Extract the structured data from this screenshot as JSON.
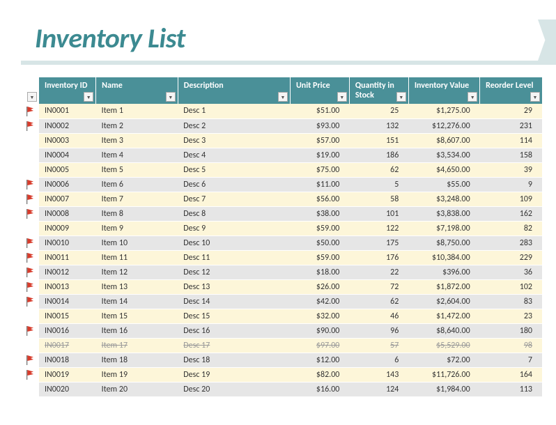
{
  "title": "Inventory List",
  "columns": [
    {
      "key": "id",
      "label": "Inventory ID"
    },
    {
      "key": "name",
      "label": "Name"
    },
    {
      "key": "desc",
      "label": "Description"
    },
    {
      "key": "price",
      "label": "Unit Price"
    },
    {
      "key": "qty",
      "label": "Quantity in Stock"
    },
    {
      "key": "value",
      "label": "Inventory Value"
    },
    {
      "key": "reorder",
      "label": "Reorder Level"
    }
  ],
  "rows": [
    {
      "flag": true,
      "strike": false,
      "id": "IN0001",
      "name": "Item 1",
      "desc": "Desc 1",
      "price": "$51.00",
      "qty": "25",
      "value": "$1,275.00",
      "reorder": "29"
    },
    {
      "flag": true,
      "strike": false,
      "id": "IN0002",
      "name": "Item 2",
      "desc": "Desc 2",
      "price": "$93.00",
      "qty": "132",
      "value": "$12,276.00",
      "reorder": "231"
    },
    {
      "flag": false,
      "strike": false,
      "id": "IN0003",
      "name": "Item 3",
      "desc": "Desc 3",
      "price": "$57.00",
      "qty": "151",
      "value": "$8,607.00",
      "reorder": "114"
    },
    {
      "flag": false,
      "strike": false,
      "id": "IN0004",
      "name": "Item 4",
      "desc": "Desc 4",
      "price": "$19.00",
      "qty": "186",
      "value": "$3,534.00",
      "reorder": "158"
    },
    {
      "flag": false,
      "strike": false,
      "id": "IN0005",
      "name": "Item 5",
      "desc": "Desc 5",
      "price": "$75.00",
      "qty": "62",
      "value": "$4,650.00",
      "reorder": "39"
    },
    {
      "flag": true,
      "strike": false,
      "id": "IN0006",
      "name": "Item 6",
      "desc": "Desc 6",
      "price": "$11.00",
      "qty": "5",
      "value": "$55.00",
      "reorder": "9"
    },
    {
      "flag": true,
      "strike": false,
      "id": "IN0007",
      "name": "Item 7",
      "desc": "Desc 7",
      "price": "$56.00",
      "qty": "58",
      "value": "$3,248.00",
      "reorder": "109"
    },
    {
      "flag": true,
      "strike": false,
      "id": "IN0008",
      "name": "Item 8",
      "desc": "Desc 8",
      "price": "$38.00",
      "qty": "101",
      "value": "$3,838.00",
      "reorder": "162"
    },
    {
      "flag": false,
      "strike": false,
      "id": "IN0009",
      "name": "Item 9",
      "desc": "Desc 9",
      "price": "$59.00",
      "qty": "122",
      "value": "$7,198.00",
      "reorder": "82"
    },
    {
      "flag": true,
      "strike": false,
      "id": "IN0010",
      "name": "Item 10",
      "desc": "Desc 10",
      "price": "$50.00",
      "qty": "175",
      "value": "$8,750.00",
      "reorder": "283"
    },
    {
      "flag": true,
      "strike": false,
      "id": "IN0011",
      "name": "Item 11",
      "desc": "Desc 11",
      "price": "$59.00",
      "qty": "176",
      "value": "$10,384.00",
      "reorder": "229"
    },
    {
      "flag": true,
      "strike": false,
      "id": "IN0012",
      "name": "Item 12",
      "desc": "Desc 12",
      "price": "$18.00",
      "qty": "22",
      "value": "$396.00",
      "reorder": "36"
    },
    {
      "flag": true,
      "strike": false,
      "id": "IN0013",
      "name": "Item 13",
      "desc": "Desc 13",
      "price": "$26.00",
      "qty": "72",
      "value": "$1,872.00",
      "reorder": "102"
    },
    {
      "flag": true,
      "strike": false,
      "id": "IN0014",
      "name": "Item 14",
      "desc": "Desc 14",
      "price": "$42.00",
      "qty": "62",
      "value": "$2,604.00",
      "reorder": "83"
    },
    {
      "flag": false,
      "strike": false,
      "id": "IN0015",
      "name": "Item 15",
      "desc": "Desc 15",
      "price": "$32.00",
      "qty": "46",
      "value": "$1,472.00",
      "reorder": "23"
    },
    {
      "flag": true,
      "strike": false,
      "id": "IN0016",
      "name": "Item 16",
      "desc": "Desc 16",
      "price": "$90.00",
      "qty": "96",
      "value": "$8,640.00",
      "reorder": "180"
    },
    {
      "flag": false,
      "strike": true,
      "id": "IN0017",
      "name": "Item 17",
      "desc": "Desc 17",
      "price": "$97.00",
      "qty": "57",
      "value": "$5,529.00",
      "reorder": "98"
    },
    {
      "flag": true,
      "strike": false,
      "id": "IN0018",
      "name": "Item 18",
      "desc": "Desc 18",
      "price": "$12.00",
      "qty": "6",
      "value": "$72.00",
      "reorder": "7"
    },
    {
      "flag": true,
      "strike": false,
      "id": "IN0019",
      "name": "Item 19",
      "desc": "Desc 19",
      "price": "$82.00",
      "qty": "143",
      "value": "$11,726.00",
      "reorder": "164"
    },
    {
      "flag": false,
      "strike": false,
      "id": "IN0020",
      "name": "Item 20",
      "desc": "Desc 20",
      "price": "$16.00",
      "qty": "124",
      "value": "$1,984.00",
      "reorder": "113"
    }
  ]
}
